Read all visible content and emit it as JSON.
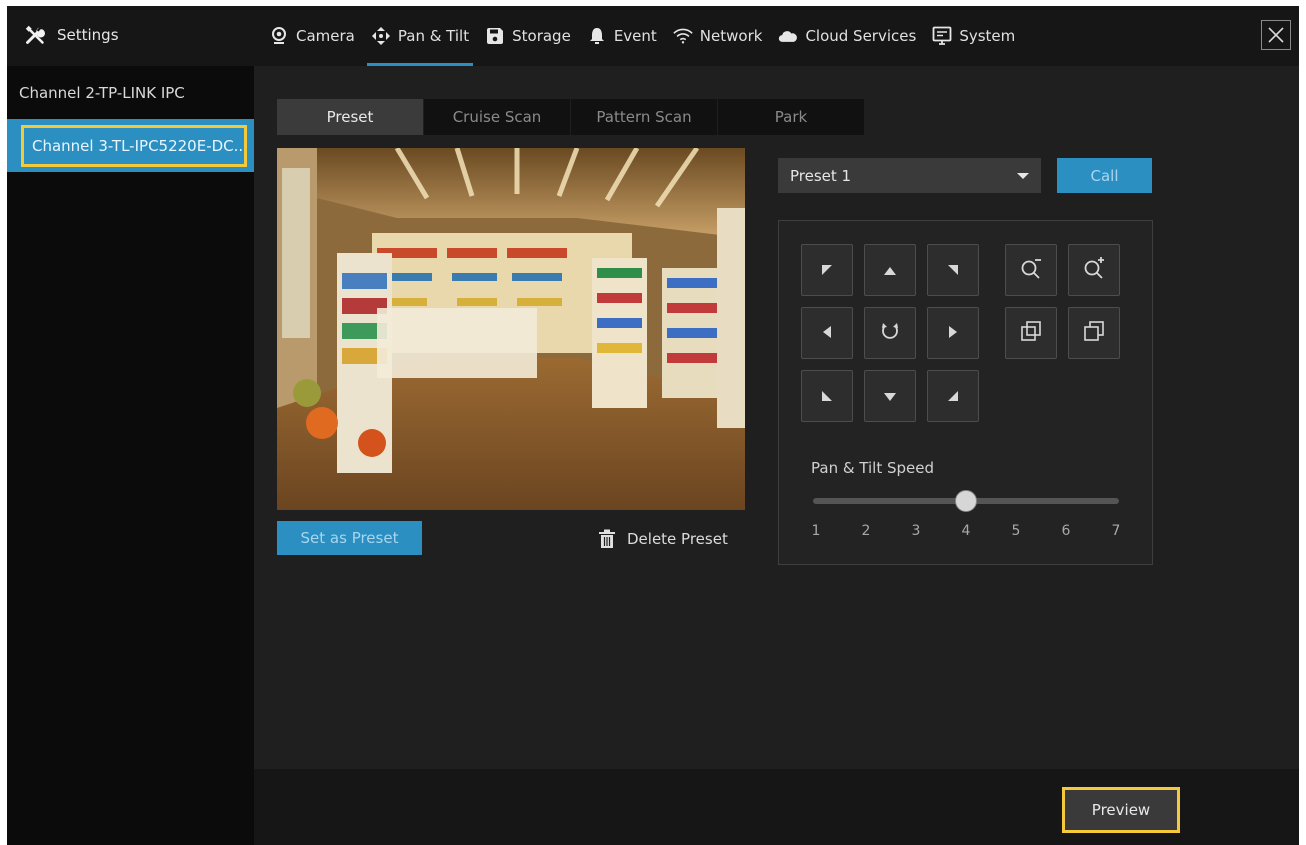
{
  "header": {
    "settings_label": "Settings",
    "tabs": [
      {
        "label": "Camera",
        "icon": "camera-icon"
      },
      {
        "label": "Pan & Tilt",
        "icon": "pan-tilt-icon"
      },
      {
        "label": "Storage",
        "icon": "storage-icon"
      },
      {
        "label": "Event",
        "icon": "bell-icon"
      },
      {
        "label": "Network",
        "icon": "wifi-icon"
      },
      {
        "label": "Cloud Services",
        "icon": "cloud-icon"
      },
      {
        "label": "System",
        "icon": "monitor-icon"
      }
    ],
    "active_tab": "Pan & Tilt"
  },
  "sidebar": {
    "channels": [
      {
        "label": "Channel 2-TP-LINK IPC",
        "selected": false
      },
      {
        "label": "Channel 3-TL-IPC5220E-DC...",
        "selected": true
      }
    ]
  },
  "subtabs": [
    "Preset",
    "Cruise Scan",
    "Pattern Scan",
    "Park"
  ],
  "active_subtab": "Preset",
  "preset": {
    "selected": "Preset 1",
    "call_label": "Call",
    "set_label": "Set as Preset",
    "delete_label": "Delete Preset"
  },
  "ptz": {
    "speed_label": "Pan & Tilt Speed",
    "speed_ticks": [
      "1",
      "2",
      "3",
      "4",
      "5",
      "6",
      "7"
    ],
    "speed_value": 4
  },
  "footer": {
    "preview_label": "Preview"
  },
  "colors": {
    "accent": "#2b8fc2",
    "highlight": "#f5c93c"
  }
}
